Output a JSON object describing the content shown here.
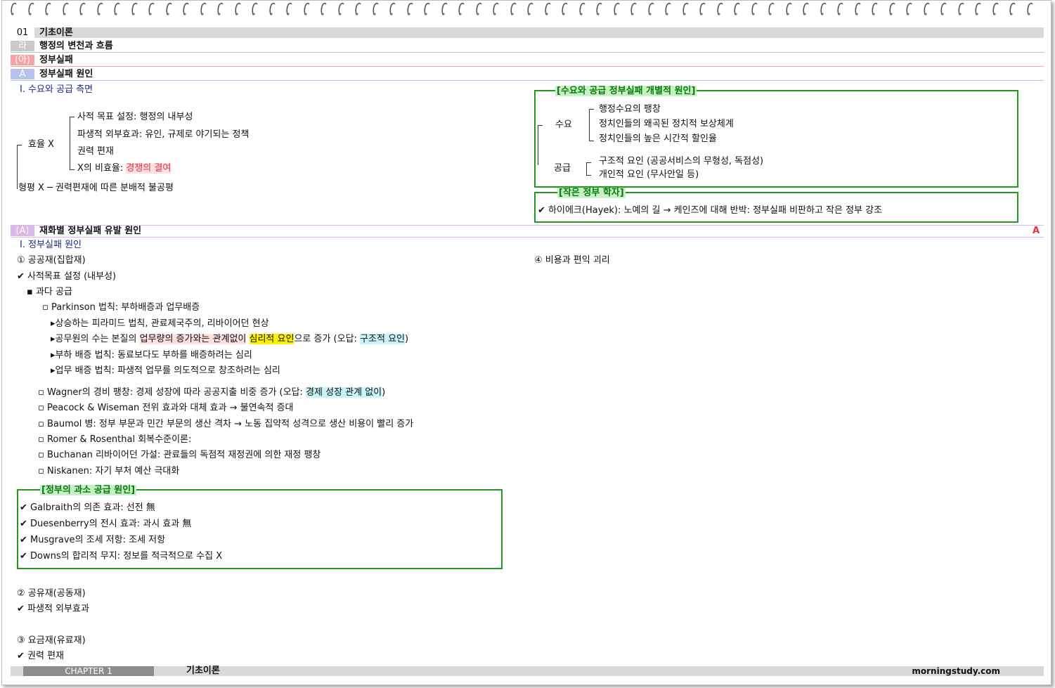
{
  "header": {
    "chapter_bar": {
      "num": "01",
      "title": "기초이론"
    },
    "section_bar": {
      "num": "라",
      "title": "행정의 변천과 흐름"
    },
    "sub_bar": {
      "num": "(아)",
      "title": "정부실패"
    },
    "topic_bar": {
      "num": "A",
      "title": "정부실패 원인"
    }
  },
  "left_top": {
    "heading": "Ⅰ. 수요와 공급 측면",
    "efficiency_label": "효율 X",
    "items": [
      "사적 목표 설정: 행정의 내부성",
      "파생적 외부효과: 유인, 규제로 야기되는 정책",
      "권력 편재"
    ],
    "x_item_prefix": "X의 비효율: ",
    "x_item_highlight": "경쟁의 결여",
    "equity_line": "형평 X ─ 권력편재에 따른 분배적 불공평"
  },
  "box_supply_demand": {
    "title": "[수요와 공급 정부실패 개별적 원인]",
    "demand_label": "수요",
    "demand_items": [
      "행정수요의 팽창",
      "정치인들의 왜곡된 정치적 보상체계",
      "정치인들의 높은 시간적 할인율"
    ],
    "supply_label": "공급",
    "supply_items": [
      "구조적 요인 (공공서비스의 무형성, 독점성)",
      "개인적 요인 (무사안일 등)"
    ]
  },
  "box_small_gov": {
    "title": "[작은 정부 학자]",
    "text": "하이에크(Hayek): 노예의 길 → 케인즈에 대해 반박: 정부실패 비판하고 작은 정부 강조"
  },
  "goods_bar": {
    "num": "(A)",
    "title": "재화별 정부실패 유발 원인",
    "mark": "A"
  },
  "goods": {
    "heading": "Ⅰ. 정부실패 원인",
    "public_goods": "① 공공재(집합재)",
    "private_goal": "사적목표 설정 (내부성)",
    "oversupply": "과다 공급",
    "parkinson": "Parkinson 법칙: 부하배증과 업무배증",
    "pk_items": {
      "a": "상승하는 피라미드 법칙, 관료제국주의, 리바이어던 현상",
      "b_pre": "공무원의 수는 본질의 ",
      "b_pink": "업무량의 증가와는 관계없이",
      "b_sp": " ",
      "b_yellow": "심리적 요인",
      "b_mid": "으로 증가 (오답: ",
      "b_cyan": "구조적 요인",
      "b_end": ")",
      "c": "부하 배증 법칙: 동료보다도 부하를 배증하려는 심리",
      "d": "업무 배증 법칙: 파생적 업무를 의도적으로 창조하려는 심리"
    },
    "wagner_pre": "Wagner의 경비 팽창: 경제 성장에 따라 공공지출 비중 증가 (오답: ",
    "wagner_cyan": "경제 성장 관계 없이",
    "wagner_end": ")",
    "more": [
      "Peacock & Wiseman 전위 효과와 대체 효과 → 불연속적 증대",
      "Baumol 병: 정부 부문과 민간 부문의 생산 격차 → 노동 집약적 성격으로 생산 비용이 빨리 증가",
      "Romer & Rosenthal 회복수준이론:",
      "Buchanan 리바이어던 가설: 관료들의 독점적 재정권에 의한 재정 팽창",
      "Niskanen: 자기 부처 예산 극대화"
    ],
    "cost_benefit": "④ 비용과 편익 괴리"
  },
  "box_undersupply": {
    "title": "[정부의 과소 공급 원인]",
    "items": [
      "Galbraith의 의존 효과: 선전 無",
      "Duesenberry의 전시 효과: 과시 효과 無",
      "Musgrave의 조세 저항: 조세 저항",
      "Downs의 합리적 무지: 정보를 적극적으로 수집 X"
    ]
  },
  "common_goods": {
    "label": "② 공유재(공동재)",
    "item": "파생적 외부효과"
  },
  "toll_goods": {
    "label": "③ 요금재(유료재)",
    "item": "권력 편재"
  },
  "checkmark": "✔",
  "bullet_square": "▪",
  "bullet_hollow": "▫",
  "bullet_tri": "▸",
  "footer": {
    "chapter": "CHAPTER 1",
    "title": "기초이론",
    "site": "morningstudy.com"
  },
  "colors": {
    "green_box": "#1e9a1e",
    "navy": "#1b2a8a",
    "pink_hl": "#fde0e0",
    "yellow_hl": "#fff200",
    "cyan_hl": "#c8f4f8"
  }
}
